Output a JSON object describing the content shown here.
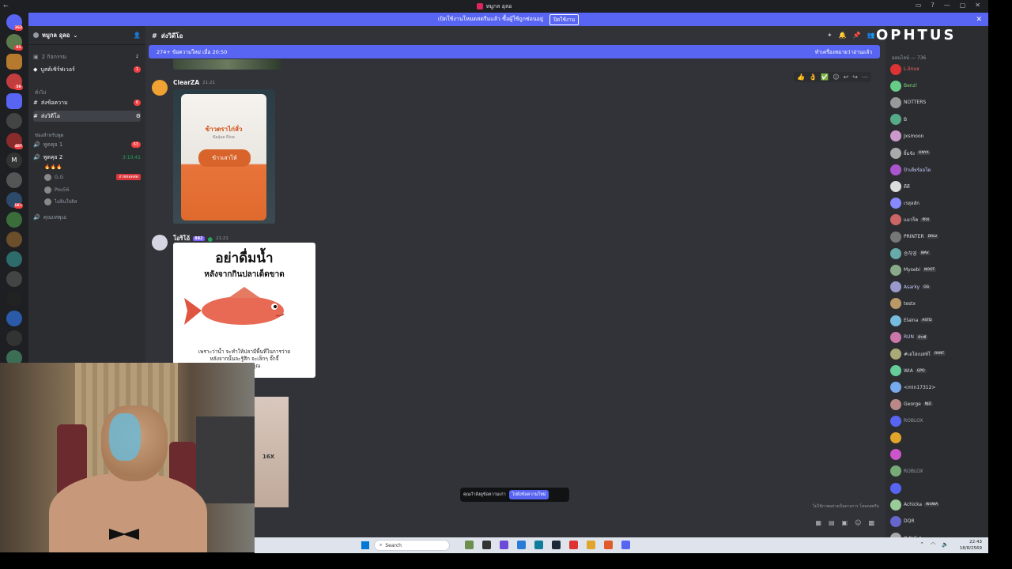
{
  "window": {
    "title": "หมูกล อุลอ",
    "controls": [
      "▭",
      "?",
      "—",
      "▢",
      "✕"
    ]
  },
  "notice": {
    "text": "เปิดใช้งานโหมดสตรีมแล้ว ซื้อผู้ใช้ถูกซ่อนอยู่",
    "button": "ปิดใช้งาน",
    "close": "✕"
  },
  "guild_badges": [
    "362",
    "91",
    "59",
    "487",
    "1K+"
  ],
  "server": {
    "name": "หมูกล อุลอ",
    "events": "2 กิจกรรม",
    "events_count": "2",
    "boost": "บูสต์เซิร์ฟเวอร์",
    "boost_count": "1",
    "cat_general": "ทั่วไป",
    "ch_text": "ส่งข้อความ",
    "ch_text_count": "6",
    "ch_video": "ส่งวิดีโอ",
    "cat_voice": "ช่องสำหรับพูด",
    "voice1": "พูดคุย 1",
    "voice1_count": "63",
    "voice2": "พูดคุย 2",
    "voice2_emoji": "🔥🔥🔥",
    "voice2_time": "3:10:41",
    "voice_users": [
      {
        "name": "G.G",
        "tag": "ถ่ายทอดสด"
      },
      {
        "name": "Pou56",
        "tag": ""
      },
      {
        "name": "ไม่ยินใจลิส",
        "tag": ""
      }
    ],
    "voice3": "คุณเทพุเอ"
  },
  "chat": {
    "channel": "ส่งวิดีโอ",
    "new_messages": "274+ ข้อความใหม่ เมื่อ 20:50",
    "mark_read": "ทำเครื่องหมายว่าอ่านแล้ว",
    "messages": [
      {
        "author": "ClearZA",
        "time": "21:21",
        "image": {
          "brand_th": "ข้าวตราไก่ลั่ว",
          "brand_en": "Kaijue Rice",
          "pill": "ข้าวเสาไห้"
        }
      },
      {
        "author": "โอริโอ้",
        "tag": "882",
        "time": "21:21",
        "card": {
          "title": "อย่าดื่มน้ำ",
          "subtitle": "หลังจากกินปลาเด็ดขาด",
          "caption_1": "เพราะว่าน้ำ จะทำให้ปลามีพื้นที่ในการว่าย",
          "caption_2": "หลังจากนั้นจะรู้สึก จะเล็กๆ จั๊กจี้",
          "caption_3": "ในท้องของคุณ"
        }
      }
    ],
    "dvd_label": "16X",
    "jump": {
      "label": "คุณกำลังดูข้อความเก่า",
      "button": "ไปยังข้อความใหม่"
    },
    "composer_hint": "ไม่ใช้ภาพอย่างเป็นทางการ โหมดสตรีม"
  },
  "brand": "OPHTUS",
  "members": {
    "category": "ออนไลน์ — 736",
    "list": [
      {
        "name": "L.linux",
        "tag": "",
        "color": "#ff6b6b"
      },
      {
        "name": "Benz!",
        "tag": "",
        "color": "#7dd87d"
      },
      {
        "name": "NOTTERS",
        "tag": "",
        "color": "#dbdee1"
      },
      {
        "name": "B",
        "tag": "",
        "color": "#dbdee1"
      },
      {
        "name": "Jxsmoon",
        "tag": "",
        "color": "#dbdee1"
      },
      {
        "name": "ยิ้มจัง",
        "tag": "ONYX",
        "color": "#dbdee1"
      },
      {
        "name": "ป้าเดียร์ออโต",
        "tag": "",
        "color": "#c9cdfb"
      },
      {
        "name": "ดีดี",
        "tag": "",
        "color": "#dbdee1"
      },
      {
        "name": "เรสุลลัก",
        "tag": "",
        "color": "#dbdee1"
      },
      {
        "name": "แมวร็ค",
        "tag": "PRX",
        "color": "#dbdee1"
      },
      {
        "name": "PRINTER",
        "tag": "DRLV",
        "color": "#dbdee1"
      },
      {
        "name": "승하영",
        "tag": "WAV",
        "color": "#dbdee1"
      },
      {
        "name": "Mysebi",
        "tag": "NOOT",
        "color": "#dbdee1"
      },
      {
        "name": "Asarky",
        "tag": "GG",
        "color": "#c9cdfb"
      },
      {
        "name": "testx",
        "tag": "",
        "color": "#dbdee1"
      },
      {
        "name": "Elaina",
        "tag": "ASTD",
        "color": "#dbdee1"
      },
      {
        "name": "RUN",
        "tag": "ล้างบี",
        "color": "#c9cdfb"
      },
      {
        "name": "#เอโย่เบสท์โ",
        "tag": "RVNT",
        "color": "#dbdee1"
      },
      {
        "name": "WIA",
        "tag": "GPO",
        "color": "#dbdee1"
      },
      {
        "name": "<min17312>",
        "tag": "",
        "color": "#dbdee1"
      },
      {
        "name": "George",
        "tag": "NJZ",
        "color": "#dbdee1"
      },
      {
        "name": "ROBLOX",
        "tag": "",
        "color": "#949ba4"
      },
      {
        "name": "",
        "tag": "",
        "color": "#dbdee1"
      },
      {
        "name": "",
        "tag": "",
        "color": "#dbdee1"
      },
      {
        "name": "ROBLOX",
        "tag": "",
        "color": "#949ba4"
      },
      {
        "name": "",
        "tag": "",
        "color": "#dbdee1"
      },
      {
        "name": "Achicka",
        "tag": "WUWA",
        "color": "#dbdee1"
      },
      {
        "name": "DQR",
        "tag": "",
        "color": "#dbdee1"
      },
      {
        "name": "O N E ♪",
        "tag": "",
        "color": "#dbdee1"
      }
    ]
  },
  "taskbar": {
    "search": "Search",
    "time": "22:43",
    "date": "18/8/2569"
  },
  "colors": {
    "blurple": "#5865f2",
    "bg": "#313338",
    "sidebar": "#2b2d31",
    "guilds": "#1e1f22"
  }
}
